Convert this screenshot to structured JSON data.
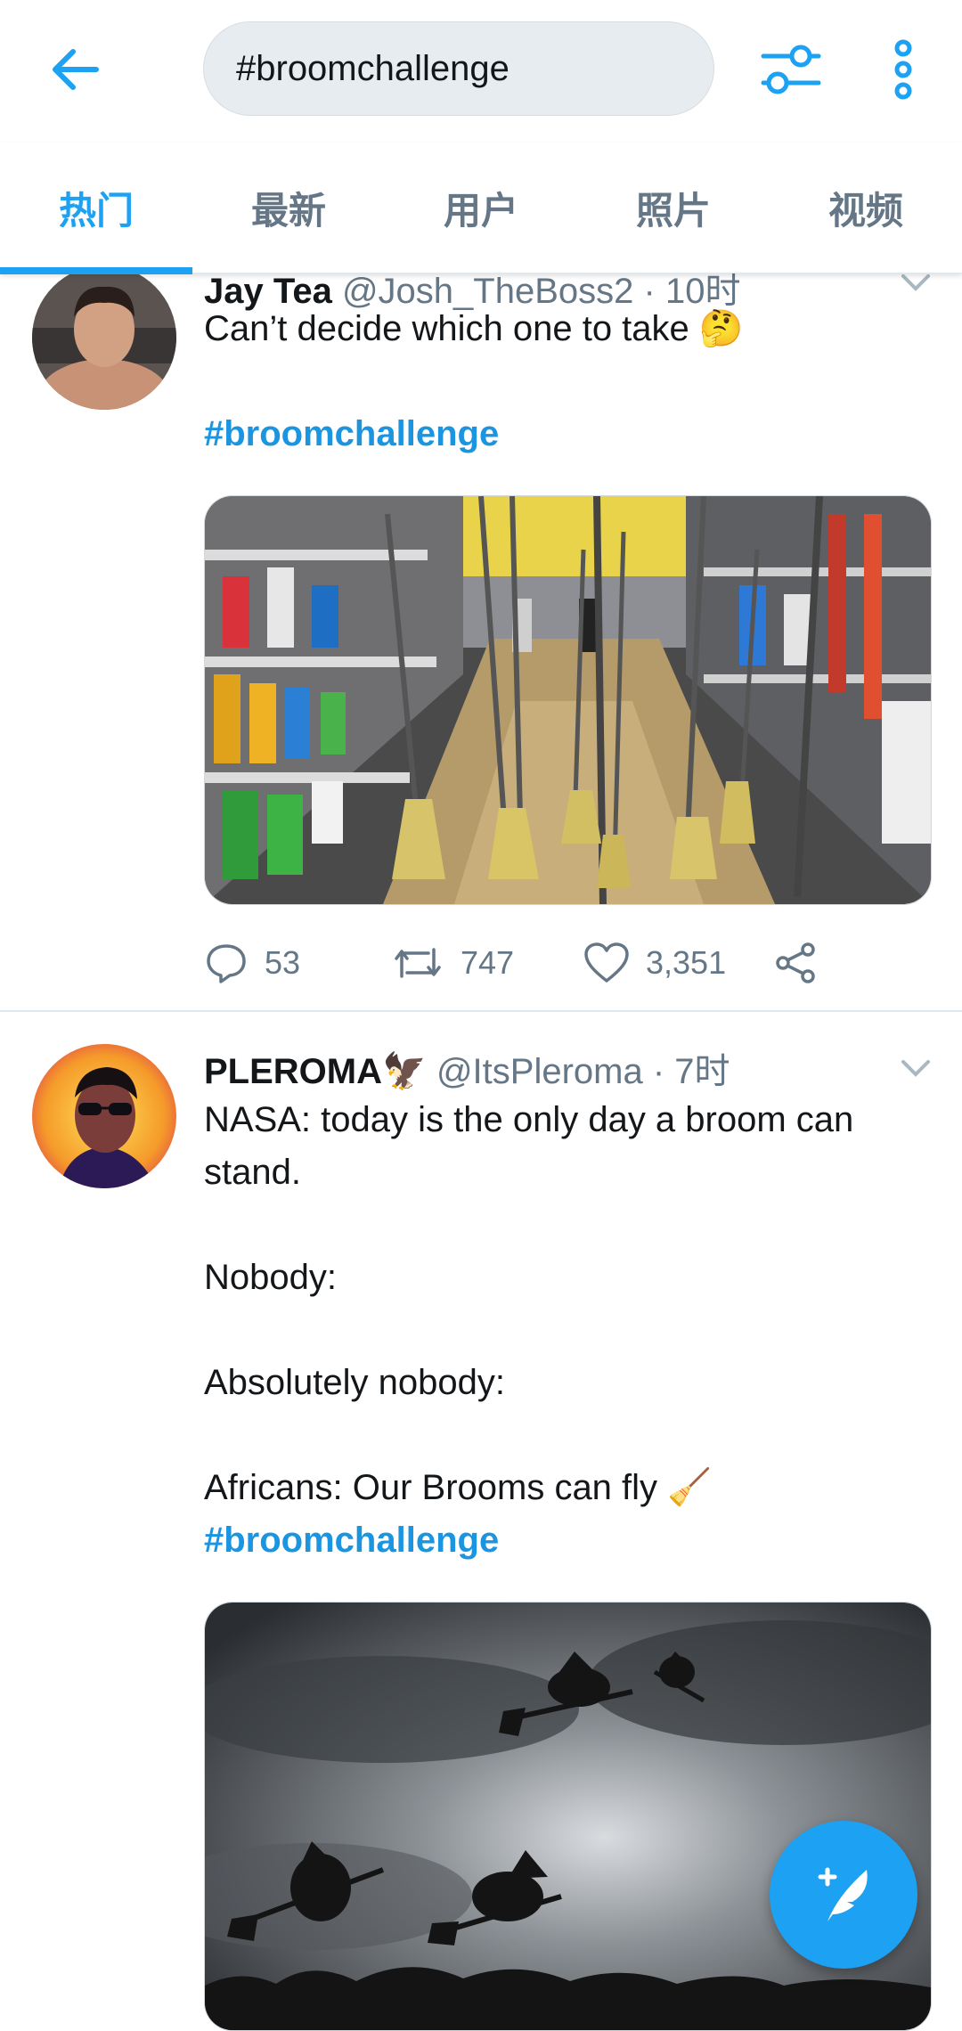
{
  "header": {
    "search_value": "#broomchallenge"
  },
  "tabs": [
    {
      "label": "热门",
      "active": true
    },
    {
      "label": "最新"
    },
    {
      "label": "用户"
    },
    {
      "label": "照片"
    },
    {
      "label": "视频"
    }
  ],
  "tweets": [
    {
      "name": "Jay Tea",
      "handle": "@Josh_TheBoss2",
      "time": "· 10时",
      "text": "Can’t decide which one to take 🤔",
      "hashtag": "#broomchallenge",
      "media_description": "store aisle with brooms standing upright",
      "stats": {
        "replies": "53",
        "retweets": "747",
        "likes": "3,351"
      }
    },
    {
      "name": "PLEROMA🦅",
      "handle": "@ItsPleroma",
      "time": "· 7时",
      "lines": [
        "NASA: today is the only day a broom can stand.",
        "Nobody:",
        "Absolutely nobody:",
        "Africans: Our Brooms can fly 🧹"
      ],
      "hashtag": "#broomchallenge",
      "media_description": "witches flying on brooms in a cloudy sky"
    }
  ],
  "colors": {
    "accent": "#1da1f2",
    "text_secondary": "#657786"
  },
  "icons": {
    "back": "arrow-left-icon",
    "filter": "sliders-icon",
    "more": "more-vertical-icon",
    "reply": "reply-icon",
    "retweet": "retweet-icon",
    "like": "heart-icon",
    "share": "share-icon",
    "compose": "compose-feather-icon"
  }
}
